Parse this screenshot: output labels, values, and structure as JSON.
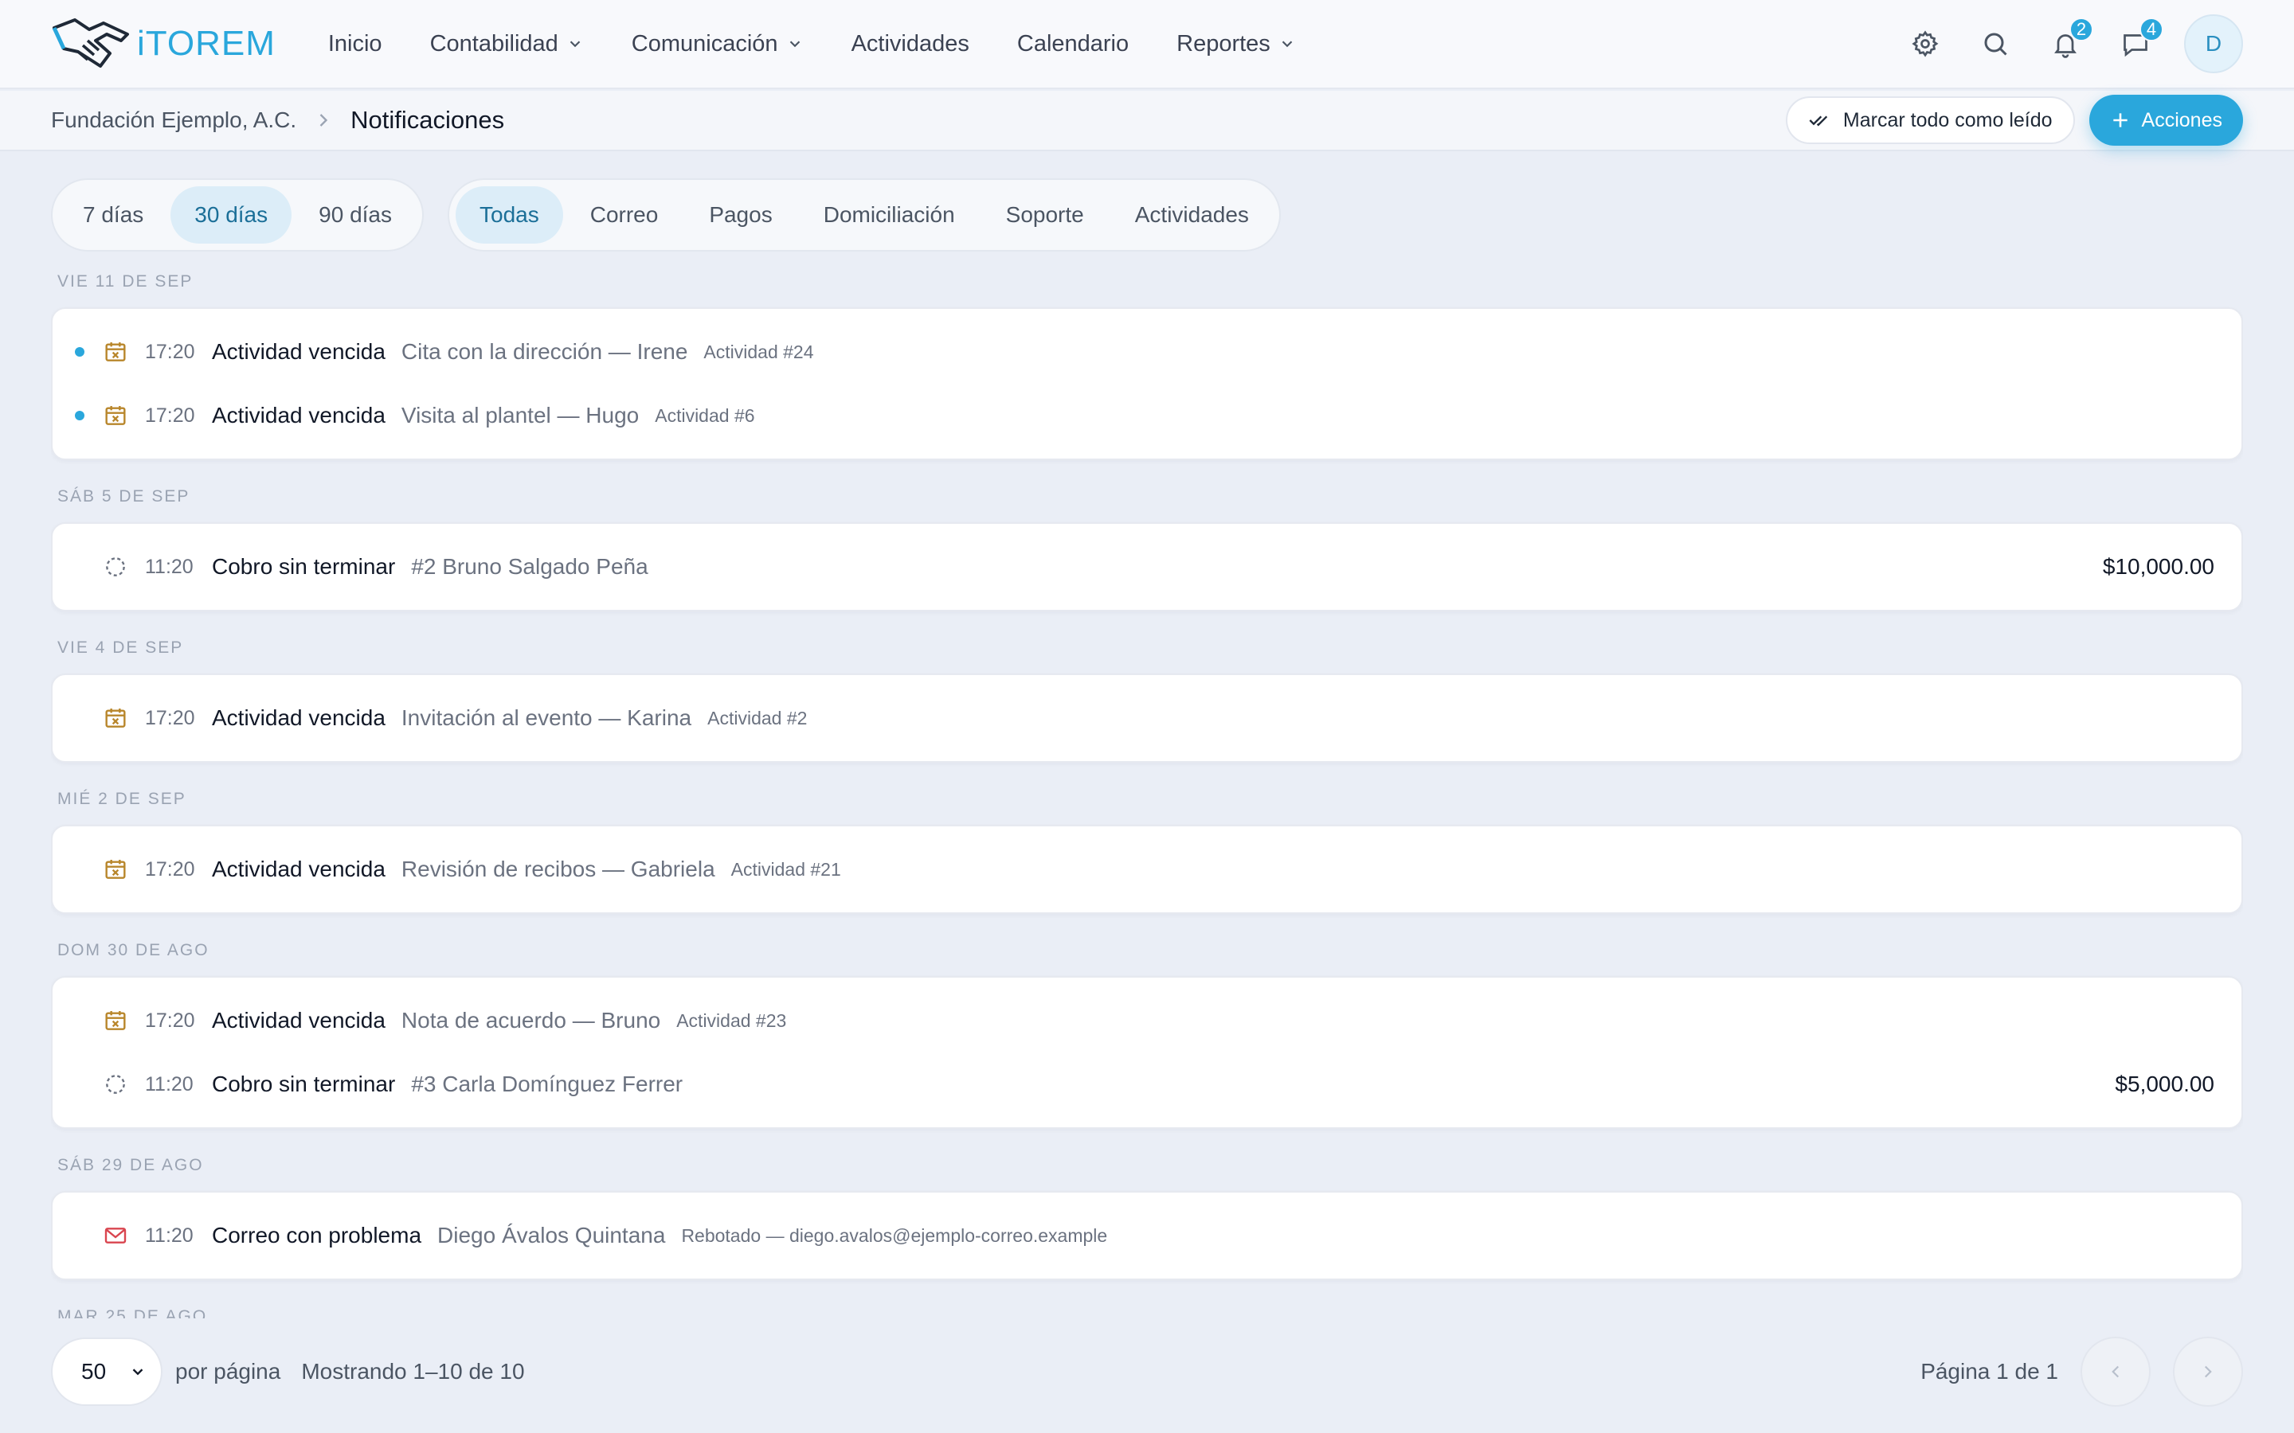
{
  "brand": {
    "name": "iTOREM",
    "color": "#2aa7dc"
  },
  "nav": {
    "items": [
      {
        "label": "Inicio",
        "dropdown": false
      },
      {
        "label": "Contabilidad",
        "dropdown": true
      },
      {
        "label": "Comunicación",
        "dropdown": true
      },
      {
        "label": "Actividades",
        "dropdown": false
      },
      {
        "label": "Calendario",
        "dropdown": false
      },
      {
        "label": "Reportes",
        "dropdown": true
      }
    ],
    "icons": [
      "gear-icon",
      "search-icon",
      "bell-icon",
      "chat-icon"
    ],
    "notification_count": "2",
    "message_count": "4",
    "avatar_initial": "D"
  },
  "breadcrumb": {
    "org": "Fundación Ejemplo, A.C.",
    "current": "Notificaciones"
  },
  "actions": {
    "mark_all_read": "Marcar todo como leído",
    "actions_label": "Acciones"
  },
  "filters": {
    "ranges": [
      {
        "label": "7 días",
        "active": false
      },
      {
        "label": "30 días",
        "active": true
      },
      {
        "label": "90 días",
        "active": false
      }
    ],
    "categories": [
      {
        "label": "Todas",
        "active": true
      },
      {
        "label": "Correo",
        "active": false
      },
      {
        "label": "Pagos",
        "active": false
      },
      {
        "label": "Domiciliación",
        "active": false
      },
      {
        "label": "Soporte",
        "active": false
      },
      {
        "label": "Actividades",
        "active": false
      }
    ]
  },
  "groups": [
    {
      "date": "VIE 11 DE SEP",
      "rows": [
        {
          "unread": true,
          "icon": "calendar-x-icon",
          "time": "17:20",
          "kind": "Actividad vencida",
          "desc": "Cita con la dirección — Irene",
          "meta": "Actividad #24",
          "amount": ""
        },
        {
          "unread": true,
          "icon": "calendar-x-icon",
          "time": "17:20",
          "kind": "Actividad vencida",
          "desc": "Visita al plantel — Hugo",
          "meta": "Actividad #6",
          "amount": ""
        }
      ]
    },
    {
      "date": "SÁB 5 DE SEP",
      "rows": [
        {
          "unread": false,
          "icon": "pending-circle-icon",
          "time": "11:20",
          "kind": "Cobro sin terminar",
          "desc": "#2 Bruno Salgado Peña",
          "meta": "",
          "amount": "$10,000.00"
        }
      ]
    },
    {
      "date": "VIE 4 DE SEP",
      "rows": [
        {
          "unread": false,
          "icon": "calendar-x-icon",
          "time": "17:20",
          "kind": "Actividad vencida",
          "desc": "Invitación al evento — Karina",
          "meta": "Actividad #2",
          "amount": ""
        }
      ]
    },
    {
      "date": "MIÉ 2 DE SEP",
      "rows": [
        {
          "unread": false,
          "icon": "calendar-x-icon",
          "time": "17:20",
          "kind": "Actividad vencida",
          "desc": "Revisión de recibos — Gabriela",
          "meta": "Actividad #21",
          "amount": ""
        }
      ]
    },
    {
      "date": "DOM 30 DE AGO",
      "rows": [
        {
          "unread": false,
          "icon": "calendar-x-icon",
          "time": "17:20",
          "kind": "Actividad vencida",
          "desc": "Nota de acuerdo — Bruno",
          "meta": "Actividad #23",
          "amount": ""
        },
        {
          "unread": false,
          "icon": "pending-circle-icon",
          "time": "11:20",
          "kind": "Cobro sin terminar",
          "desc": "#3 Carla Domínguez Ferrer",
          "meta": "",
          "amount": "$5,000.00"
        }
      ]
    },
    {
      "date": "SÁB 29 DE AGO",
      "rows": [
        {
          "unread": false,
          "icon": "mail-icon",
          "time": "11:20",
          "kind": "Correo con problema",
          "desc": "Diego Ávalos Quintana",
          "meta": "Rebotado — diego.avalos@ejemplo-correo.example",
          "amount": ""
        }
      ]
    },
    {
      "date": "MAR 25 DE AGO",
      "rows": []
    }
  ],
  "footer": {
    "per_page_value": "50",
    "per_page_label": "por página",
    "showing": "Mostrando 1–10 de 10",
    "page_info": "Página 1 de 1"
  },
  "colors": {
    "accent": "#2aa7dc",
    "unread_dot": "#2aa7dc",
    "activity_icon": "#b8862b",
    "mail_icon": "#d9454f",
    "pending_icon": "#6b7280"
  }
}
